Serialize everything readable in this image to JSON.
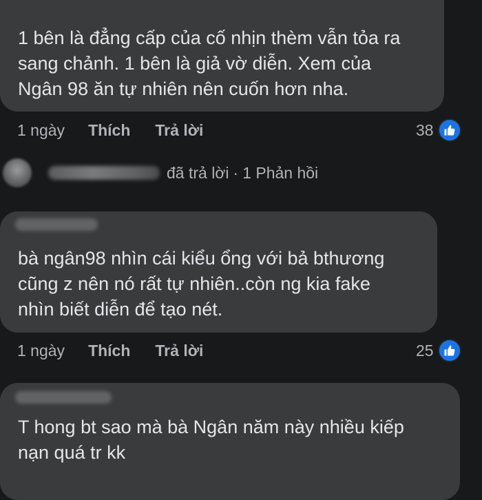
{
  "comments": [
    {
      "text": "1 bên là đẳng cấp của cố nhịn thèm vẫn tỏa ra\nsang chảnh. 1 bên là giả vờ diễn. Xem của\nNgân 98 ăn tự nhiên nên cuốn hơn nha.",
      "time": "1 ngày",
      "like_label": "Thích",
      "reply_label": "Trả lời",
      "reaction_count": "38"
    },
    {
      "text": "bà ngân98 nhìn cái kiểu ổng với bả bthương\ncũng z nên nó rất tự nhiên..còn ng kia fake\nnhìn biết diễn để tạo nét.",
      "time": "1 ngày",
      "like_label": "Thích",
      "reply_label": "Trả lời",
      "reaction_count": "25"
    },
    {
      "text": "T hong bt sao mà bà Ngân năm này nhiều kiếp\nnạn quá tr kk"
    }
  ],
  "reply_summary": {
    "action": "đã trả lời",
    "separator": "·",
    "count_label": "1 Phản hồi"
  },
  "colors": {
    "background": "#18191a",
    "bubble": "#3a3b3c",
    "text": "#e4e6eb",
    "muted": "#b0b3b8",
    "like_blue": "#1b74e4"
  },
  "icons": {
    "reaction": "like-thumb-icon",
    "avatar": "avatar"
  }
}
